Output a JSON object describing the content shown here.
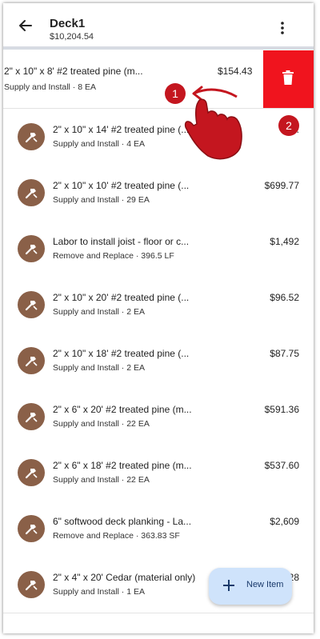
{
  "header": {
    "title": "Deck1",
    "subtitle": "$10,204.54"
  },
  "swiped_item": {
    "title": "2\" x 10\" x 8' #2 treated pine (m...",
    "subtitle": "Supply and Install · 8 EA",
    "price": "$154.43",
    "delete_icon": "trash-icon",
    "delete_color": "#f0141e"
  },
  "annotations": {
    "step1": "1",
    "step2": "2",
    "color": "#c4161f"
  },
  "items": [
    {
      "title": "2\" x 10\" x 14' #2 treated pine (...",
      "subtitle": "Supply and Install · 4 EA",
      "price": "$1...",
      "icon": "hammer-icon"
    },
    {
      "title": "2\" x 10\" x 10' #2 treated pine (...",
      "subtitle": "Supply and Install · 29 EA",
      "price": "$699.77",
      "icon": "hammer-icon"
    },
    {
      "title": "Labor to install joist - floor or c...",
      "subtitle": "Remove and Replace · 396.5 LF",
      "price": "$1,492",
      "icon": "hammer-icon"
    },
    {
      "title": "2\" x 10\" x 20' #2 treated pine (...",
      "subtitle": "Supply and Install · 2 EA",
      "price": "$96.52",
      "icon": "hammer-icon"
    },
    {
      "title": "2\" x 10\" x 18' #2 treated pine (...",
      "subtitle": "Supply and Install · 2 EA",
      "price": "$87.75",
      "icon": "hammer-icon"
    },
    {
      "title": "2\" x 6\" x 20' #2 treated pine (m...",
      "subtitle": "Supply and Install · 22 EA",
      "price": "$591.36",
      "icon": "hammer-icon"
    },
    {
      "title": "2\" x 6\" x 18' #2 treated pine (m...",
      "subtitle": "Supply and Install · 22 EA",
      "price": "$537.60",
      "icon": "hammer-icon"
    },
    {
      "title": "6\" softwood deck planking - La...",
      "subtitle": "Remove and Replace · 363.83 SF",
      "price": "$2,609",
      "icon": "hammer-icon"
    },
    {
      "title": "2\" x 4\" x 20' Cedar (material only)",
      "subtitle": "Supply and Install · 1 EA",
      "price": "...28",
      "icon": "hammer-icon"
    }
  ],
  "fab": {
    "label": "New Item",
    "icon": "plus-icon"
  },
  "colors": {
    "avatar": "#8a6048",
    "fab_bg": "#cfe3fb",
    "fab_text": "#1a3a6b"
  }
}
